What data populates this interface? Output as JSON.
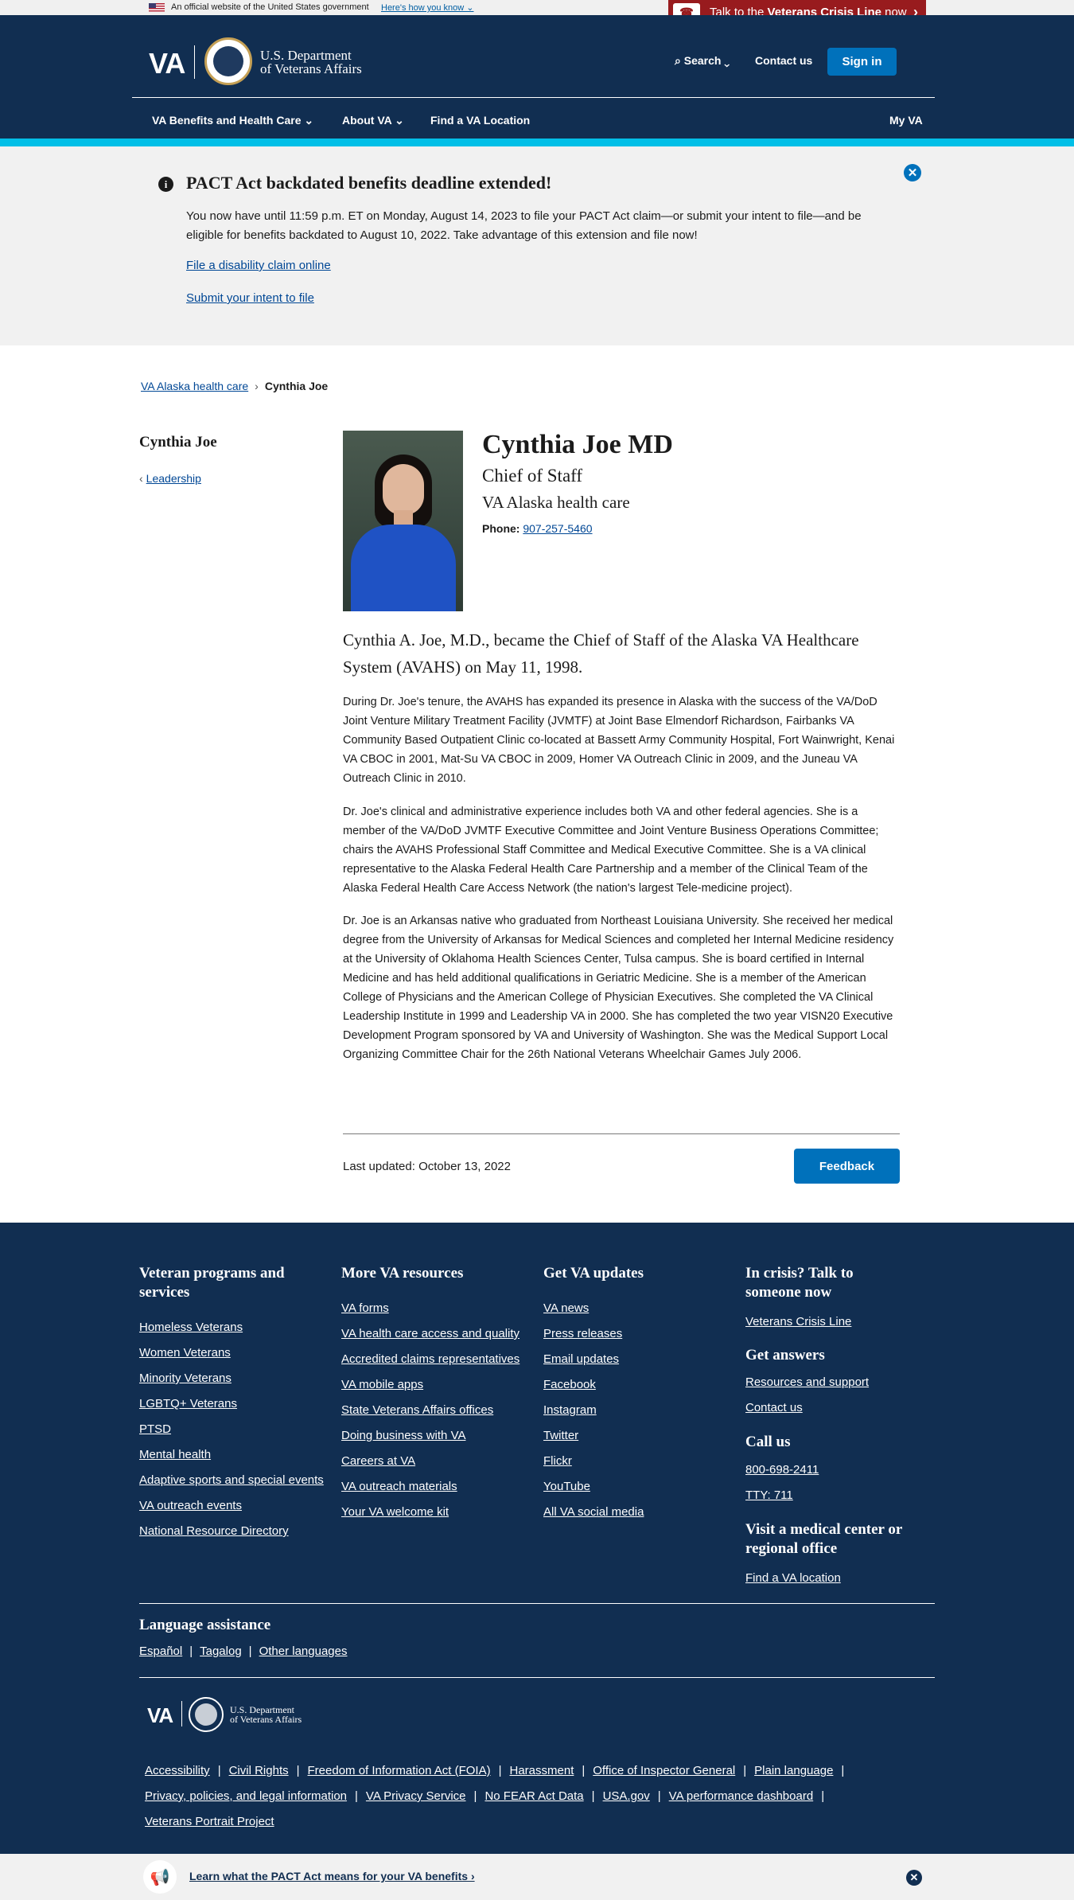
{
  "gov_banner": {
    "text": "An official website of the United States government",
    "link": "Here's how you know ⌄"
  },
  "crisis": {
    "icon": "☎",
    "prefix": "Talk to the ",
    "bold": "Veterans Crisis Line",
    "suffix": " now",
    "chevron": "›"
  },
  "header": {
    "logo_va": "VA",
    "dept_line1": "U.S. Department",
    "dept_line2": "of Veterans Affairs",
    "search": "⌕ Search ⌄",
    "contact": "Contact us",
    "signin": "Sign in",
    "nav": [
      "VA Benefits and Health Care ⌄",
      "About VA ⌄",
      "Find a VA Location",
      "My VA"
    ]
  },
  "alert": {
    "icon": "i",
    "title": "PACT Act backdated benefits deadline extended!",
    "body": "You now have until 11:59 p.m. ET on Monday, August 14, 2023 to file your PACT Act claim—or submit your intent to file—and be eligible for benefits backdated to August 10, 2022. Take advantage of this extension and file now!",
    "link1": "File a disability claim online",
    "link2": "Submit your intent to file",
    "close": "✕"
  },
  "breadcrumb": {
    "parent": "VA Alaska health care",
    "sep": "›",
    "current": "Cynthia Joe"
  },
  "sidebar": {
    "title": "Cynthia Joe",
    "chevron": "‹",
    "link": "Leadership"
  },
  "profile": {
    "name": "Cynthia Joe MD",
    "role": "Chief of Staff",
    "org": "VA Alaska health care",
    "phone_label": "Phone:",
    "phone": "907-257-5460"
  },
  "bio": {
    "lead": "Cynthia A. Joe, M.D., became the Chief of Staff of the Alaska VA Healthcare System (AVAHS) on May 11, 1998.",
    "p1": "During Dr. Joe's tenure, the AVAHS has expanded its presence in Alaska with the success of the VA/DoD Joint Venture Military Treatment Facility (JVMTF) at Joint Base Elmendorf Richardson, Fairbanks VA Community Based Outpatient Clinic co-located at Bassett Army Community Hospital, Fort Wainwright, Kenai VA CBOC in 2001, Mat-Su VA CBOC in 2009, Homer VA Outreach Clinic in 2009, and the Juneau VA Outreach Clinic in 2010.",
    "p2": "Dr. Joe's clinical and administrative experience includes both VA and other federal agencies. She is a member of the VA/DoD JVMTF Executive Committee and Joint Venture Business Operations Committee; chairs the AVAHS Professional Staff Committee and Medical Executive Committee. She is a VA clinical representative to the Alaska Federal Health Care Partnership and a member of the Clinical Team of the Alaska Federal Health Care Access Network (the nation's largest Tele-medicine project).",
    "p3": "Dr. Joe is an Arkansas native who graduated from Northeast Louisiana University. She received her medical degree from the University of Arkansas for Medical Sciences and completed her Internal Medicine residency at the University of Oklahoma Health Sciences Center, Tulsa campus. She is board certified in Internal Medicine and has held additional qualifications in Geriatric Medicine. She is a member of the American College of Physicians and the American College of Physician Executives. She completed the VA Clinical Leadership Institute in 1999 and Leadership VA in 2000. She has completed the two year VISN20 Executive Development Program sponsored by VA and University of Washington. She was the Medical Support Local Organizing Committee Chair for the 26th National Veterans Wheelchair Games July 2006."
  },
  "updated": {
    "text": "Last updated: October 13, 2022",
    "feedback": "Feedback"
  },
  "footer": {
    "col1": {
      "title": "Veteran programs and services",
      "links": [
        "Homeless Veterans",
        "Women Veterans",
        "Minority Veterans",
        "LGBTQ+ Veterans",
        "PTSD",
        "Mental health",
        "Adaptive sports and special events",
        "VA outreach events",
        "National Resource Directory"
      ]
    },
    "col2": {
      "title": "More VA resources",
      "links": [
        "VA forms",
        "VA health care access and quality",
        "Accredited claims representatives",
        "VA mobile apps",
        "State Veterans Affairs offices",
        "Doing business with VA",
        "Careers at VA",
        "VA outreach materials",
        "Your VA welcome kit"
      ]
    },
    "col3": {
      "title": "Get VA updates",
      "links": [
        "VA news",
        "Press releases",
        "Email updates",
        "Facebook",
        "Instagram",
        "Twitter",
        "Flickr",
        "YouTube",
        "All VA social media"
      ]
    },
    "col4": {
      "crisis_title": "In crisis? Talk to someone now",
      "crisis_link": "Veterans Crisis Line",
      "answers_title": "Get answers",
      "answers_links": [
        "Resources and support",
        "Contact us"
      ],
      "call_title": "Call us",
      "call_links": [
        "800-698-2411",
        "TTY: 711"
      ],
      "visit_title": "Visit a medical center or regional office",
      "visit_link": "Find a VA location"
    },
    "language": {
      "title": "Language assistance",
      "links": [
        "Español",
        "Tagalog",
        "Other languages"
      ],
      "sep": "|"
    },
    "logo": {
      "va": "VA",
      "dept_line1": "U.S. Department",
      "dept_line2": "of Veterans Affairs"
    },
    "legal_row1": [
      "Accessibility",
      "Civil Rights",
      "Freedom of Information Act (FOIA)",
      "Harassment",
      "Office of Inspector General",
      "Plain language"
    ],
    "legal_row2": [
      "Privacy, policies, and legal information",
      "VA Privacy Service",
      "No FEAR Act Data",
      "USA.gov",
      "VA performance dashboard"
    ],
    "legal_row3": [
      "Veterans Portrait Project"
    ]
  },
  "promo": {
    "icon": "📢",
    "text": "Learn what the PACT Act means for your VA benefits ›",
    "close": "✕"
  }
}
